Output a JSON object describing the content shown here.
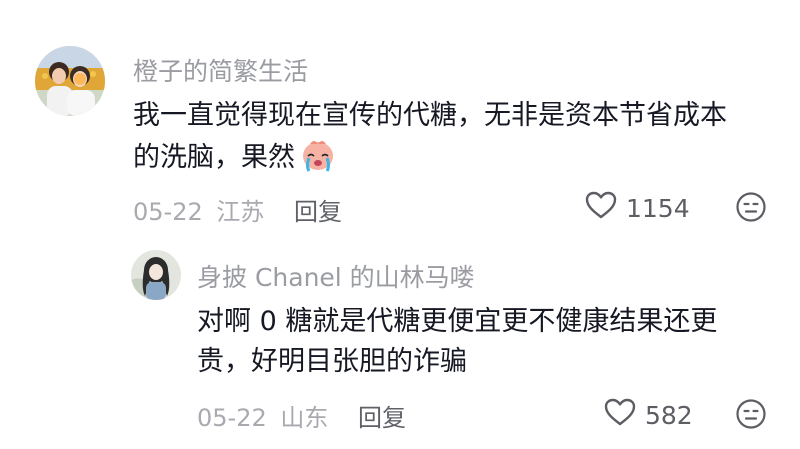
{
  "comments": [
    {
      "username": "橙子的简繁生活",
      "text_lines": [
        "我一直觉得现在宣传的代糖，无非是资本节省成本",
        "的洗脑，果然"
      ],
      "emoji": "crying-face-emoji",
      "date": "05-22",
      "location": "江苏",
      "reply_label": "回复",
      "likes": "1154"
    },
    {
      "username": "身披 Chanel 的山林马喽",
      "text_lines": [
        "对啊 0 糖就是代糖更便宜更不健康结果还更",
        "贵，好明目张胆的诈骗"
      ],
      "date": "05-22",
      "location": "山东",
      "reply_label": "回复",
      "likes": "582"
    }
  ],
  "icons": {
    "like": "heart-outline-icon",
    "dislike": "meh-face-icon"
  },
  "colors": {
    "username": "#9a9ca2",
    "text": "#161823",
    "meta": "#a8aaaf",
    "icon": "#5c5e64"
  }
}
